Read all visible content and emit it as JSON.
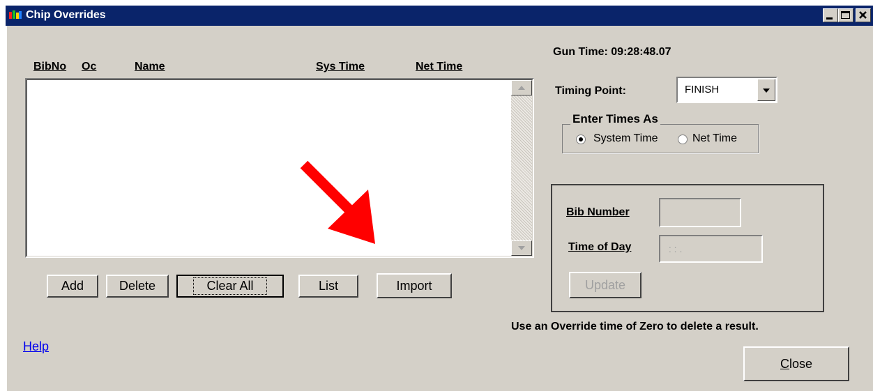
{
  "window": {
    "title": "Chip Overrides",
    "controls": {
      "minimize": "_",
      "maximize": "□",
      "close": "×"
    }
  },
  "list": {
    "columns": [
      "BibNo",
      "Oc",
      "Name",
      "Sys Time",
      "Net Time"
    ],
    "rows": []
  },
  "buttons": {
    "add": "Add",
    "delete": "Delete",
    "clear_all": "Clear All",
    "list": "List",
    "import": "Import",
    "update": "Update",
    "close_prefix": "C",
    "close_rest": "lose"
  },
  "gun_time": "Gun Time: 09:28:48.07",
  "timing_point": {
    "label": "Timing Point:",
    "value": "FINISH"
  },
  "enter_times": {
    "title": "Enter Times As",
    "options": [
      "System Time",
      "Net Time"
    ],
    "selected": "System Time"
  },
  "entry": {
    "bib_label": "Bib Number",
    "bib_value": "",
    "time_label": "Time of Day",
    "time_placeholder": " : : ."
  },
  "note": "Use an Override time of Zero to delete a result.",
  "help": "Help",
  "annotation": {
    "arrow_color": "#ff0000",
    "points_to": "Import"
  },
  "colors": {
    "title_bar": "#0a246a",
    "dialog_bg": "#d4d0c8",
    "link": "#0000ee"
  }
}
